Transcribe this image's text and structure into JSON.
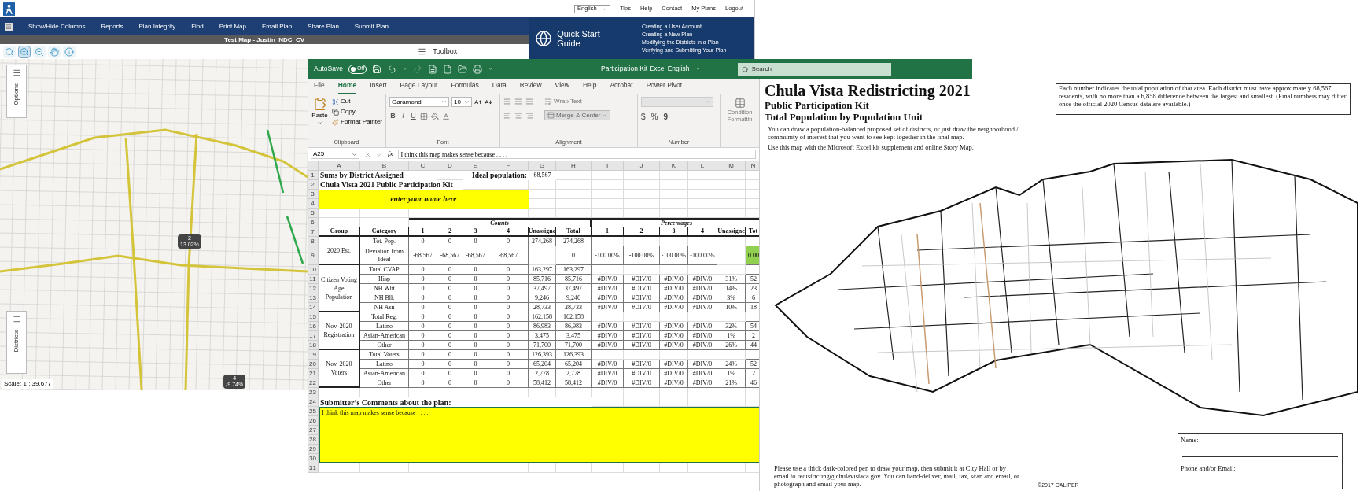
{
  "web_app": {
    "language": "English",
    "header_links": [
      "Tips",
      "Help",
      "Contact",
      "My Plans",
      "Logout"
    ],
    "menu": [
      "Show/Hide Columns",
      "Reports",
      "Plan Integrity",
      "Find",
      "Print Map",
      "Email Plan",
      "Share Plan",
      "Submit Plan"
    ],
    "map_title": "Test Map - Justin_NDC_CV",
    "tools": [
      {
        "kind": "zoom_extent",
        "selected": false
      },
      {
        "kind": "zoom_in",
        "selected": true
      },
      {
        "kind": "zoom_out",
        "selected": false
      },
      {
        "kind": "pan",
        "selected": false
      },
      {
        "kind": "info",
        "selected": false
      }
    ],
    "toolbox": {
      "title": "Toolbox"
    },
    "side_tabs": [
      "Options",
      "Districts"
    ],
    "district_labels": [
      {
        "district": "2",
        "deviation": "13.02%"
      },
      {
        "district": "4",
        "deviation": "-9.74%"
      }
    ],
    "scale": "Scale: 1 : 39,677",
    "quick_start": {
      "title": "Quick Start Guide",
      "links": [
        "Creating a User Account",
        "Creating a New Plan",
        "Modifying the Districts in a Plan",
        "Verifying and Submitting Your Plan"
      ]
    }
  },
  "excel": {
    "autosave": {
      "label": "AutoSave",
      "on": false,
      "state_text": "Off"
    },
    "title": "Participation Kit Excel English",
    "search": {
      "placeholder": "Search"
    },
    "tabs": [
      {
        "label": "File",
        "selected": false
      },
      {
        "label": "Home",
        "selected": true
      },
      {
        "label": "Insert",
        "selected": false
      },
      {
        "label": "Page Layout",
        "selected": false
      },
      {
        "label": "Formulas",
        "selected": false
      },
      {
        "label": "Data",
        "selected": false
      },
      {
        "label": "Review",
        "selected": false
      },
      {
        "label": "View",
        "selected": false
      },
      {
        "label": "Help",
        "selected": false
      },
      {
        "label": "Acrobat",
        "selected": false
      },
      {
        "label": "Power Pivot",
        "selected": false
      }
    ],
    "ribbon": {
      "clipboard": {
        "paste": "Paste",
        "cut": "Cut",
        "copy": "Copy",
        "format_painter": "Format Painter",
        "label": "Clipboard"
      },
      "font": {
        "name": "Garamond",
        "size": "10",
        "bold": "B",
        "italic": "I",
        "underline": "U",
        "label": "Font"
      },
      "alignment": {
        "wrap": "Wrap Text",
        "merge": "Merge & Center",
        "label": "Alignment"
      },
      "number": {
        "currency": "$",
        "percent": "%",
        "comma": "9",
        "label": "Number"
      },
      "conditional": [
        "Condition",
        "Formattin"
      ]
    },
    "name_box": "A25",
    "fx": "fx",
    "formula": "I think this map makes sense because . . . .",
    "sheet": {
      "columns": [
        "A",
        "B",
        "C",
        "D",
        "E",
        "F",
        "G",
        "H",
        "I",
        "J",
        "K",
        "L",
        "M",
        "N"
      ],
      "row_numbers": [
        "1",
        "2",
        "3",
        "4",
        "5",
        "6",
        "7",
        "8",
        "9",
        "10",
        "11",
        "12",
        "13",
        "14",
        "15",
        "16",
        "17",
        "18",
        "19",
        "20",
        "21",
        "22",
        "23",
        "24",
        "25",
        "26",
        "27",
        "28",
        "29",
        "30",
        "31"
      ],
      "title": "Sums by District Assigned",
      "ideal_label": "Ideal population:",
      "ideal_value": "68,567",
      "subtitle": "Chula Vista 2021 Public Participation Kit",
      "name_prompt": "enter your name here",
      "counts_label": "Counts",
      "percentages_label": "Percentages",
      "headers": [
        "Group",
        "Category",
        "1",
        "2",
        "3",
        "4",
        "Unassigne",
        "Total",
        "1",
        "2",
        "3",
        "4",
        "Unassigne",
        "Tot"
      ],
      "groups": [
        {
          "label": "2020 Est.",
          "rows": [
            {
              "category": "Tot. Pop.",
              "tall": false,
              "highlight": false,
              "values": {
                "c1": "0",
                "c2": "0",
                "c3": "0",
                "c4": "0",
                "unassigned": "274,268",
                "total": "274,268"
              }
            },
            {
              "category": "Deviation from Ideal",
              "tall": true,
              "highlight": true,
              "values": {
                "c1": "-68,567",
                "c2": "-68,567",
                "c3": "-68,567",
                "c4": "-68,567",
                "total": "0",
                "p1": "-100.00%",
                "p2": "-100.00%",
                "p3": "-100.00%",
                "p4": "-100.00%",
                "p_total": "0.00"
              }
            }
          ]
        },
        {
          "label": "Citizen Voting Age Population",
          "rows": [
            {
              "category": "Total CVAP",
              "tall": false,
              "highlight": false,
              "values": {
                "c1": "0",
                "c2": "0",
                "c3": "0",
                "c4": "0",
                "unassigned": "163,297",
                "total": "163,297"
              }
            },
            {
              "category": "Hisp",
              "tall": false,
              "highlight": false,
              "values": {
                "c1": "0",
                "c2": "0",
                "c3": "0",
                "c4": "0",
                "unassigned": "85,716",
                "total": "85,716",
                "p1": "#DIV/0",
                "p2": "#DIV/0",
                "p3": "#DIV/0",
                "p4": "#DIV/0",
                "p_unassigned": "31%",
                "p_total": "52"
              }
            },
            {
              "category": "NH Wht",
              "tall": false,
              "highlight": false,
              "values": {
                "c1": "0",
                "c2": "0",
                "c3": "0",
                "c4": "0",
                "unassigned": "37,497",
                "total": "37,497",
                "p1": "#DIV/0",
                "p2": "#DIV/0",
                "p3": "#DIV/0",
                "p4": "#DIV/0",
                "p_unassigned": "14%",
                "p_total": "23"
              }
            },
            {
              "category": "NH Blk",
              "tall": false,
              "highlight": false,
              "values": {
                "c1": "0",
                "c2": "0",
                "c3": "0",
                "c4": "0",
                "unassigned": "9,246",
                "total": "9,246",
                "p1": "#DIV/0",
                "p2": "#DIV/0",
                "p3": "#DIV/0",
                "p4": "#DIV/0",
                "p_unassigned": "3%",
                "p_total": "6"
              }
            },
            {
              "category": "NH Asn",
              "tall": false,
              "highlight": false,
              "values": {
                "c1": "0",
                "c2": "0",
                "c3": "0",
                "c4": "0",
                "unassigned": "28,733",
                "total": "28,733",
                "p1": "#DIV/0",
                "p2": "#DIV/0",
                "p3": "#DIV/0",
                "p4": "#DIV/0",
                "p_unassigned": "10%",
                "p_total": "18"
              }
            }
          ]
        },
        {
          "label": "Nov. 2020 Registration",
          "rows": [
            {
              "category": "Total Reg.",
              "tall": false,
              "highlight": false,
              "values": {
                "c1": "0",
                "c2": "0",
                "c3": "0",
                "c4": "0",
                "unassigned": "162,158",
                "total": "162,158"
              }
            },
            {
              "category": "Latino",
              "tall": false,
              "highlight": false,
              "values": {
                "c1": "0",
                "c2": "0",
                "c3": "0",
                "c4": "0",
                "unassigned": "86,983",
                "total": "86,983",
                "p1": "#DIV/0",
                "p2": "#DIV/0",
                "p3": "#DIV/0",
                "p4": "#DIV/0",
                "p_unassigned": "32%",
                "p_total": "54"
              }
            },
            {
              "category": "Asian-American",
              "tall": false,
              "highlight": false,
              "values": {
                "c1": "0",
                "c2": "0",
                "c3": "0",
                "c4": "0",
                "unassigned": "3,475",
                "total": "3,475",
                "p1": "#DIV/0",
                "p2": "#DIV/0",
                "p3": "#DIV/0",
                "p4": "#DIV/0",
                "p_unassigned": "1%",
                "p_total": "2"
              }
            },
            {
              "category": "Other",
              "tall": false,
              "highlight": false,
              "values": {
                "c1": "0",
                "c2": "0",
                "c3": "0",
                "c4": "0",
                "unassigned": "71,700",
                "total": "71,700",
                "p1": "#DIV/0",
                "p2": "#DIV/0",
                "p3": "#DIV/0",
                "p4": "#DIV/0",
                "p_unassigned": "26%",
                "p_total": "44"
              }
            }
          ]
        },
        {
          "label": "Nov. 2020 Voters",
          "rows": [
            {
              "category": "Total Voters",
              "tall": false,
              "highlight": false,
              "values": {
                "c1": "0",
                "c2": "0",
                "c3": "0",
                "c4": "0",
                "unassigned": "126,393",
                "total": "126,393"
              }
            },
            {
              "category": "Latino",
              "tall": false,
              "highlight": false,
              "values": {
                "c1": "0",
                "c2": "0",
                "c3": "0",
                "c4": "0",
                "unassigned": "65,204",
                "total": "65,204",
                "p1": "#DIV/0",
                "p2": "#DIV/0",
                "p3": "#DIV/0",
                "p4": "#DIV/0",
                "p_unassigned": "24%",
                "p_total": "52"
              }
            },
            {
              "category": "Asian-American",
              "tall": false,
              "highlight": false,
              "values": {
                "c1": "0",
                "c2": "0",
                "c3": "0",
                "c4": "0",
                "unassigned": "2,778",
                "total": "2,778",
                "p1": "#DIV/0",
                "p2": "#DIV/0",
                "p3": "#DIV/0",
                "p4": "#DIV/0",
                "p_unassigned": "1%",
                "p_total": "2"
              }
            },
            {
              "category": "Other",
              "tall": false,
              "highlight": false,
              "values": {
                "c1": "0",
                "c2": "0",
                "c3": "0",
                "c4": "0",
                "unassigned": "58,412",
                "total": "58,412",
                "p1": "#DIV/0",
                "p2": "#DIV/0",
                "p3": "#DIV/0",
                "p4": "#DIV/0",
                "p_unassigned": "21%",
                "p_total": "46"
              }
            }
          ]
        }
      ],
      "comment_title": "Submitter’s Comments about the plan:",
      "comment": "I think this map makes sense because . . . ."
    }
  },
  "flyer": {
    "title": "Chula Vista Redistricting 2021",
    "subtitle": "Public Participation Kit",
    "heading": "Total Population by Population Unit",
    "paragraphs": [
      "You can draw a population-balanced proposed set of districts, or just draw the neighborhood / community of interest that you want to see kept together in the final map.",
      "Use this map with the Microsoft Excel kit supplement and online Story Map."
    ],
    "note": "Each number indicates the total population of that area. Each district must have approximately 68,567 residents, with no more than a 6,858 difference between the largest and smallest. (Final numbers may differ once the official 2020 Census data are available.)",
    "instructions": "Please use a thick dark-colored pen to draw your map, then submit it at City Hall or by email to redistricting@chulavistaca.gov. You can hand-deliver, mail, fax, scan and email, or photograph and email your map.",
    "form_fields": [
      "Name:",
      "Phone and/or Email:"
    ],
    "copyright": "©2017 CALIPER"
  }
}
